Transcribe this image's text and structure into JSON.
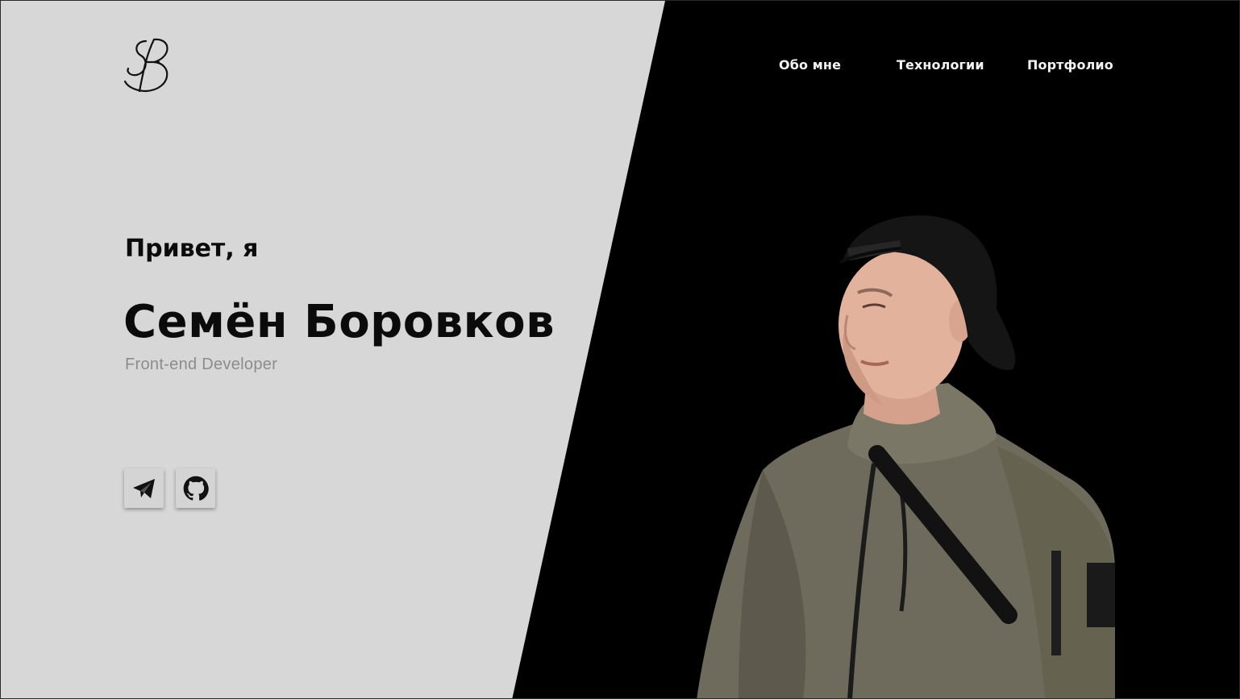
{
  "nav": {
    "items": [
      {
        "label": "Обо мне"
      },
      {
        "label": "Технологии"
      },
      {
        "label": "Портфолио"
      }
    ]
  },
  "hero": {
    "greeting": "Привет, я",
    "name": "Семён Боровков",
    "role": "Front-end Developer"
  },
  "socials": [
    {
      "icon": "telegram-icon"
    },
    {
      "icon": "github-icon"
    }
  ],
  "colors": {
    "light_panel": "#d7d7d7",
    "dark_panel": "#000000",
    "text_dark": "#0b0b0b",
    "text_muted": "#8c8c8c",
    "nav_text": "#f2f2f2"
  }
}
